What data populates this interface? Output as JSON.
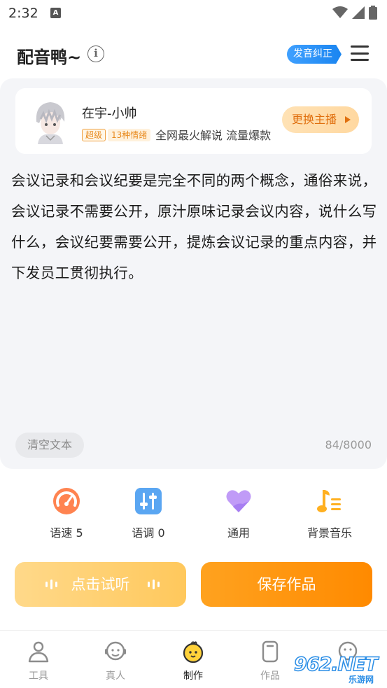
{
  "status_bar": {
    "time": "2:32",
    "notification_letter": "A"
  },
  "header": {
    "title": "配音鸭~",
    "info_glyph": "i",
    "correction_badge": "发音纠正"
  },
  "voice": {
    "name": "在宇-小帅",
    "tag_level": "超级",
    "tag_emotion": "13种情绪",
    "description": "全网最火解说 流量爆款",
    "switch_label": "更换主播"
  },
  "editor": {
    "text": "会议记录和会议纪要是完全不同的两个概念，通俗来说，会议记录不需要公开，原汁原味记录会议内容，说什么写什么，会议纪要需要公开，提炼会议记录的重点内容，并下发员工贯彻执行。",
    "clear_label": "清空文本",
    "char_count": "84/8000"
  },
  "controls": [
    {
      "label": "语速 5",
      "icon": "speed-gauge-icon",
      "color": "#ff7a45"
    },
    {
      "label": "语调 0",
      "icon": "tone-sliders-icon",
      "color": "#4a9cf0"
    },
    {
      "label": "通用",
      "icon": "heart-icon",
      "color": "#b48cf5"
    },
    {
      "label": "背景音乐",
      "icon": "music-note-icon",
      "color": "#ffb020"
    }
  ],
  "actions": {
    "listen_label": "点击试听",
    "save_label": "保存作品"
  },
  "nav": [
    {
      "label": "工具",
      "icon": "tool-icon"
    },
    {
      "label": "真人",
      "icon": "human-voice-icon"
    },
    {
      "label": "制作",
      "icon": "duck-icon",
      "active": true
    },
    {
      "label": "作品",
      "icon": "works-icon"
    },
    {
      "label": "",
      "icon": "profile-icon"
    }
  ],
  "watermark": {
    "main": "962.NET",
    "sub": "乐游网"
  },
  "colors": {
    "accent_orange": "#ff8a00",
    "accent_blue": "#1a85f0",
    "editor_bg": "#f4f5f8"
  }
}
